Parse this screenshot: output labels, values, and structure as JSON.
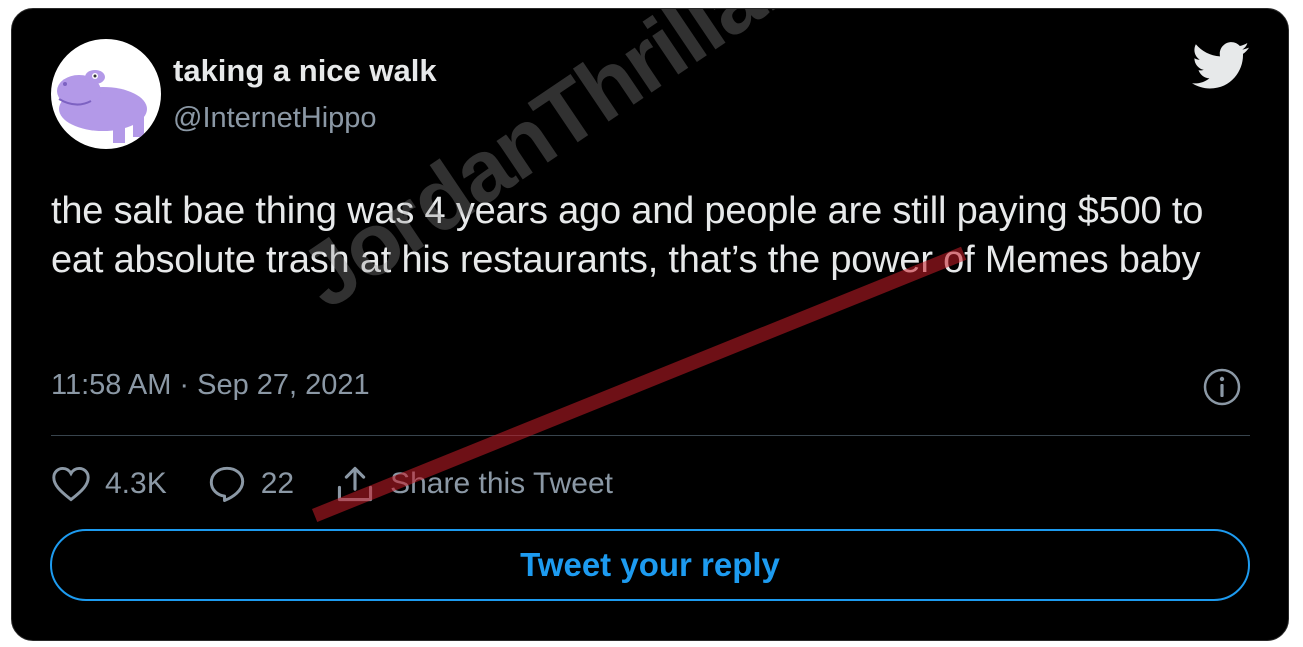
{
  "tweet": {
    "author": {
      "display_name": "taking a nice walk",
      "handle": "@InternetHippo"
    },
    "text": "the salt bae thing was 4 years ago and people are still paying $500 to eat absolute trash at his restaurants, that’s the power of Memes baby",
    "timestamp": "11:58 AM · Sep 27, 2021",
    "likes": "4.3K",
    "replies": "22",
    "share_label": "Share this Tweet",
    "reply_button_label": "Tweet your reply"
  },
  "watermark": {
    "text": "JordanThrilla."
  },
  "icons": {
    "logo": "twitter-bird-icon",
    "info": "info-icon",
    "like": "heart-icon",
    "reply": "speech-bubble-icon",
    "share": "share-icon"
  },
  "colors": {
    "background": "#000000",
    "text": "#e7e9ea",
    "secondary_text": "#8b98a5",
    "accent": "#1d9bf0",
    "avatar_hippo": "#b399e8"
  }
}
